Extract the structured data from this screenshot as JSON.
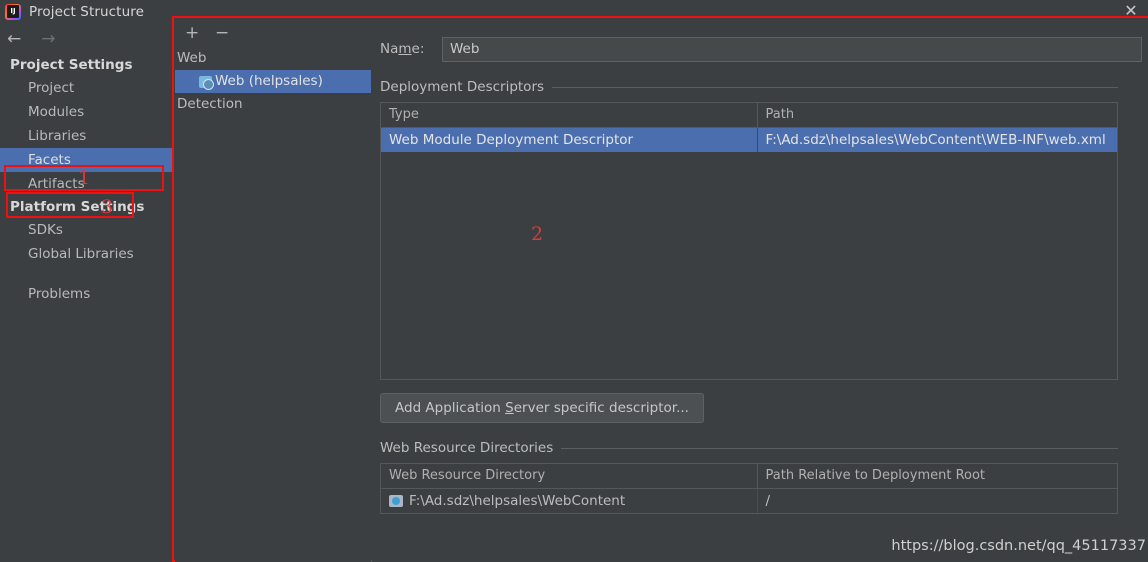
{
  "window": {
    "title": "Project Structure",
    "app_icon": "intellij-idea-icon",
    "close_icon": "close-icon"
  },
  "sidebar": {
    "back_icon": "arrow-left-icon",
    "forward_icon": "arrow-right-icon",
    "groups": [
      {
        "title": "Project Settings",
        "items": [
          {
            "label": "Project",
            "selected": false
          },
          {
            "label": "Modules",
            "selected": false
          },
          {
            "label": "Libraries",
            "selected": false
          },
          {
            "label": "Facets",
            "selected": true
          },
          {
            "label": "Artifacts",
            "selected": false
          }
        ]
      },
      {
        "title": "Platform Settings",
        "items": [
          {
            "label": "SDKs",
            "selected": false
          },
          {
            "label": "Global Libraries",
            "selected": false
          }
        ]
      }
    ],
    "problems_label": "Problems"
  },
  "annotations": {
    "one": "1",
    "two": "2",
    "three": "3",
    "color": "#ee1111"
  },
  "tree": {
    "add_icon": "plus-icon",
    "remove_icon": "minus-icon",
    "rows": [
      {
        "label": "Web",
        "child": false,
        "selected": false,
        "icon": ""
      },
      {
        "label": "Web (helpsales)",
        "child": true,
        "selected": true,
        "icon": "web-facet-icon"
      },
      {
        "label": "Detection",
        "child": false,
        "selected": false,
        "icon": ""
      }
    ]
  },
  "form": {
    "name_label_pre": "Na",
    "name_label_accel": "m",
    "name_label_post": "e:",
    "name_value": "Web",
    "name_placeholder": "Name"
  },
  "deployment": {
    "section_title": "Deployment Descriptors",
    "columns": [
      "Type",
      "Path"
    ],
    "rows": [
      {
        "type": "Web Module Deployment Descriptor",
        "path": "F:\\Ad.sdz\\helpsales\\WebContent\\WEB-INF\\web.xml",
        "selected": true
      }
    ],
    "tools": [
      "plus-icon",
      "minus-icon",
      "pencil-icon"
    ],
    "button_pre": "Add Application ",
    "button_accel": "S",
    "button_post": "erver specific descriptor..."
  },
  "resources": {
    "section_title": "Web Resource Directories",
    "columns": [
      "Web Resource Directory",
      "Path Relative to Deployment Root"
    ],
    "rows": [
      {
        "directory": "F:\\Ad.sdz\\helpsales\\WebContent",
        "relative_path": "/",
        "icon": "folder-module-icon"
      }
    ],
    "tools": [
      "plus-icon"
    ]
  },
  "watermark": {
    "text": "https://blog.csdn.net/qq_45117337"
  }
}
